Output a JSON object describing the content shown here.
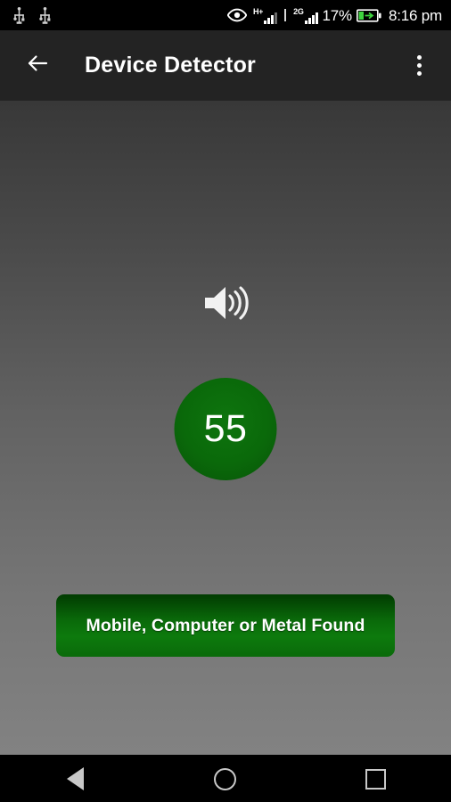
{
  "status_bar": {
    "left_icons": [
      "usb-icon",
      "usb-icon"
    ],
    "eye_icon": "eye-icon",
    "signal_1_label": "H+",
    "signal_1_bars": 3,
    "signal_2_label": "2G",
    "signal_2_bars": 4,
    "battery_percent": "17%",
    "battery_icon": "battery-charging-icon",
    "clock": "8:16 pm"
  },
  "app_bar": {
    "back_icon": "arrow-left-icon",
    "title": "Device Detector",
    "overflow_icon": "more-vertical-icon"
  },
  "main": {
    "speaker_icon": "volume-high-icon",
    "meter_value": "55",
    "status_button_label": "Mobile, Computer or Metal Found"
  },
  "nav_bar": {
    "back_label": "back-triangle-icon",
    "home_label": "home-circle-icon",
    "recents_label": "recents-square-icon"
  },
  "colors": {
    "app_bar_bg": "#232323",
    "status_bar_bg": "#000000",
    "meter_green": "#0a690a",
    "button_green": "#0a6a0a",
    "battery_green": "#3fd43f",
    "background_top": "#383838",
    "background_bottom": "#828282"
  }
}
